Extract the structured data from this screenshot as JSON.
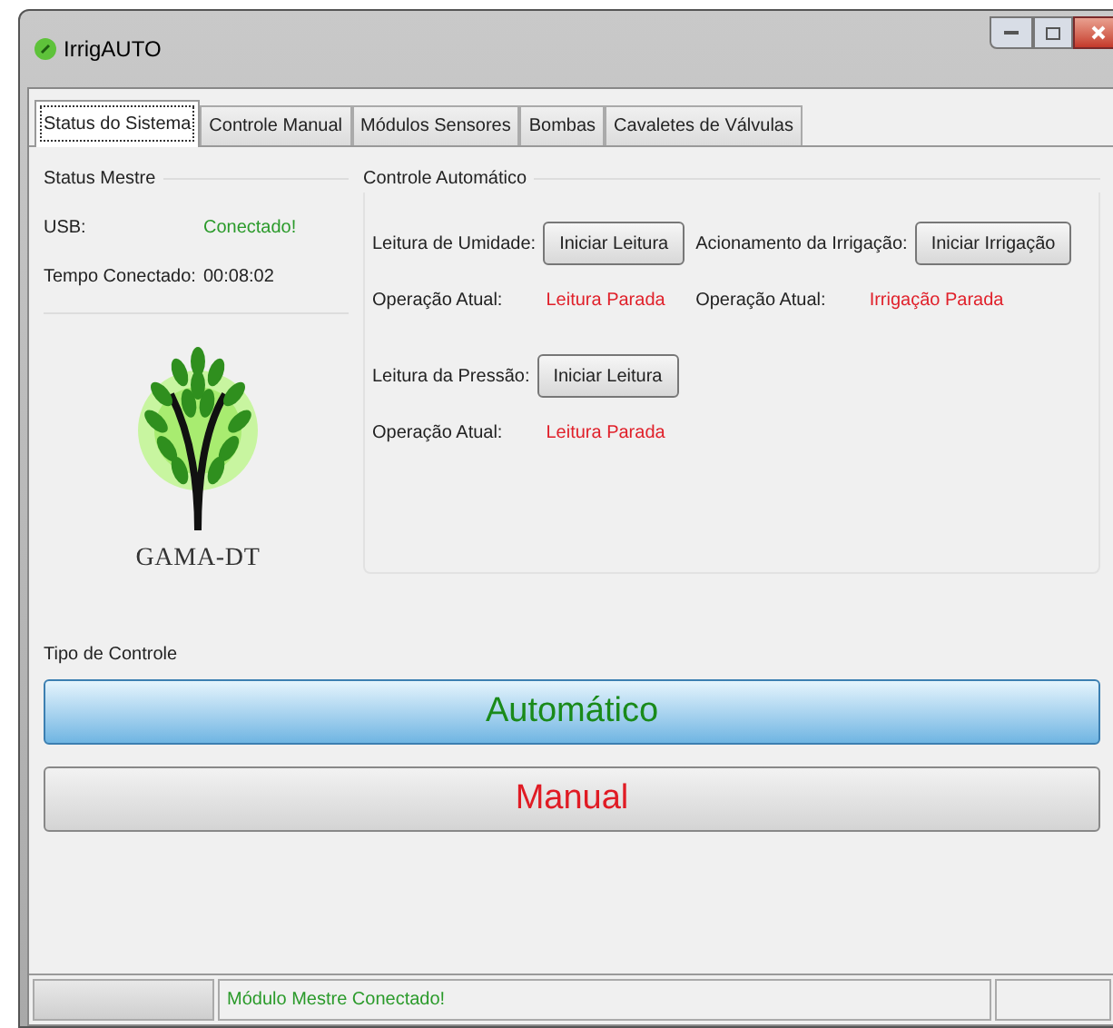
{
  "window": {
    "title": "IrrigAUTO"
  },
  "tabs": [
    {
      "label": "Status do Sistema",
      "selected": true
    },
    {
      "label": "Controle Manual",
      "selected": false
    },
    {
      "label": "Módulos Sensores",
      "selected": false
    },
    {
      "label": "Bombas",
      "selected": false
    },
    {
      "label": "Cavaletes de Válvulas",
      "selected": false
    }
  ],
  "status_mestre": {
    "title": "Status Mestre",
    "rows": [
      {
        "label": "USB:",
        "value": "Conectado!",
        "kind": "ok"
      },
      {
        "label": "Tempo Conectado:",
        "value": "00:08:02",
        "kind": "plain"
      }
    ]
  },
  "logo": {
    "text": "GAMA-DT"
  },
  "controle_automatico": {
    "title": "Controle Automático",
    "blocks": [
      {
        "label": "Leitura de Umidade:",
        "button": "Iniciar Leitura",
        "status_label": "Operação Atual:",
        "status": "Leitura Parada",
        "kind": "stopped"
      },
      {
        "label": "Acionamento da Irrigação:",
        "button": "Iniciar Irrigação",
        "status_label": "Operação Atual:",
        "status": "Irrigação Parada",
        "kind": "stopped"
      },
      {
        "label": "Leitura da Pressão:",
        "button": "Iniciar Leitura",
        "status_label": "Operação Atual:",
        "status": "Leitura Parada",
        "kind": "stopped"
      }
    ]
  },
  "tipo_de_controle": {
    "title": "Tipo de Controle",
    "options": [
      {
        "label": "Automático",
        "selected": true,
        "kind": "auto"
      },
      {
        "label": "Manual",
        "selected": false,
        "kind": "manual"
      }
    ]
  },
  "status_bar": {
    "message": "Módulo Mestre Conectado!",
    "kind": "ok"
  }
}
